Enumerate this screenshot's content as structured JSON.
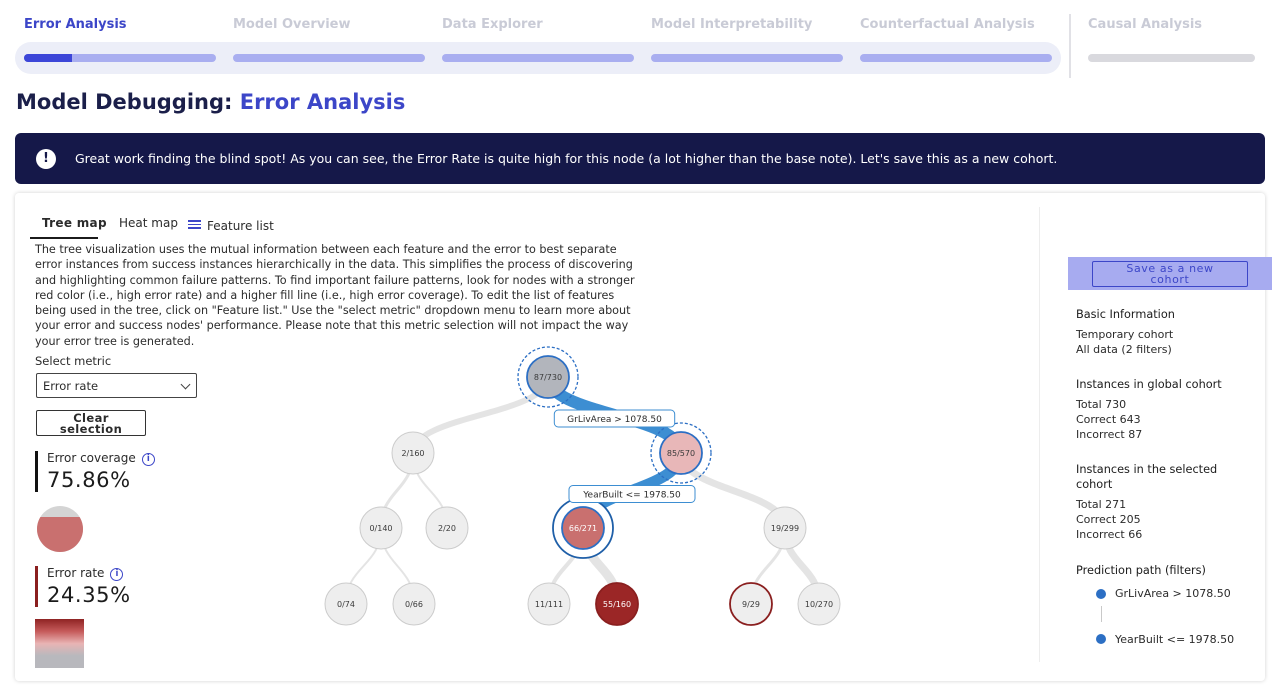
{
  "steps": [
    {
      "label": "Error Analysis",
      "active": true,
      "progress": 0.25
    },
    {
      "label": "Model Overview",
      "active": false,
      "progress": 0
    },
    {
      "label": "Data Explorer",
      "active": false,
      "progress": 0
    },
    {
      "label": "Model Interpretability",
      "active": false,
      "progress": 0
    },
    {
      "label": "Counterfactual Analysis",
      "active": false,
      "progress": 0
    },
    {
      "label": "Causal Analysis",
      "active": false,
      "progress": 0
    }
  ],
  "title": {
    "prefix": "Model Debugging:",
    "accent": "Error Analysis"
  },
  "banner": {
    "icon": "!",
    "text": "Great work finding the blind spot! As you can see, the Error Rate is quite high for this node (a lot higher than the base note). Let's save this as a new cohort."
  },
  "tabs": {
    "tree_map": "Tree map",
    "heat_map": "Heat map",
    "feature_list": "Feature list"
  },
  "description": "The tree visualization uses the mutual information between each feature and the error to best separate error instances from success instances hierarchically in the data. This simplifies the process of discovering and highlighting common failure patterns. To find important failure patterns, look for nodes with a stronger red color (i.e., high error rate) and a higher fill line (i.e., high error coverage). To edit the list of features being used in the tree, click on \"Feature list.\" Use the \"select metric\" dropdown menu to learn more about your error and success nodes' performance. Please note that this metric selection will not impact the way your error tree is generated.",
  "metric": {
    "label": "Select metric",
    "selected": "Error rate"
  },
  "clear_button": {
    "line1": "Clear",
    "line2": "selection"
  },
  "coverage": {
    "label": "Error coverage",
    "value": "75.86%",
    "fraction": 0.7586,
    "info_icon": "i"
  },
  "error_rate": {
    "label": "Error rate",
    "value": "24.35%",
    "info_icon": "i"
  },
  "colors": {
    "accent": "#3c46c8",
    "banner_bg": "#151849",
    "edge_selected": "#3d8ed2",
    "edge_default": "#e4e4e4"
  },
  "tree": {
    "nodes": [
      {
        "id": "root",
        "label": "87/730",
        "fill": "#b2b5bc",
        "stroke": "#2c6fc4",
        "ring": "dashed",
        "light": false
      },
      {
        "id": "n1",
        "label": "2/160",
        "fill": "#eeeeee",
        "stroke": "#cccccc",
        "ring": "none",
        "light": false
      },
      {
        "id": "n2",
        "label": "85/570",
        "fill": "#e8b7b8",
        "stroke": "#2c6fc4",
        "ring": "dashed",
        "light": false
      },
      {
        "id": "n3",
        "label": "0/140",
        "fill": "#eeeeee",
        "stroke": "#cccccc",
        "ring": "none",
        "light": false
      },
      {
        "id": "n4",
        "label": "2/20",
        "fill": "#eeeeee",
        "stroke": "#cccccc",
        "ring": "none",
        "light": false
      },
      {
        "id": "n5",
        "label": "66/271",
        "fill": "#c9706f",
        "stroke": "#2c6fc4",
        "ring": "solid",
        "light": true
      },
      {
        "id": "n6",
        "label": "19/299",
        "fill": "#eeeeee",
        "stroke": "#cccccc",
        "ring": "none",
        "light": false
      },
      {
        "id": "n7",
        "label": "0/74",
        "fill": "#eeeeee",
        "stroke": "#cccccc",
        "ring": "none",
        "light": false
      },
      {
        "id": "n8",
        "label": "0/66",
        "fill": "#eeeeee",
        "stroke": "#cccccc",
        "ring": "none",
        "light": false
      },
      {
        "id": "n9",
        "label": "11/111",
        "fill": "#eeeeee",
        "stroke": "#cccccc",
        "ring": "none",
        "light": false
      },
      {
        "id": "n10",
        "label": "55/160",
        "fill": "#9b2626",
        "stroke": "#8a1f1f",
        "ring": "none",
        "light": true
      },
      {
        "id": "n11",
        "label": "9/29",
        "fill": "#eeeeee",
        "stroke": "#8a1f1f",
        "ring": "none",
        "light": false
      },
      {
        "id": "n12",
        "label": "10/270",
        "fill": "#eeeeee",
        "stroke": "#cccccc",
        "ring": "none",
        "light": false
      }
    ],
    "edge_labels": [
      {
        "from": "root",
        "to": "n2",
        "text": "GrLivArea > 1078.50"
      },
      {
        "from": "n2",
        "to": "n5",
        "text": "YearBuilt <= 1978.50"
      }
    ]
  },
  "save_button": {
    "line1": "Save as a new",
    "line2": "cohort"
  },
  "basic_info": {
    "heading": "Basic Information",
    "lines": [
      "Temporary cohort",
      "All data (2 filters)"
    ]
  },
  "global_cohort": {
    "heading": "Instances in global cohort",
    "lines": [
      "Total 730",
      "Correct 643",
      "Incorrect 87"
    ]
  },
  "selected_cohort": {
    "heading_line1": "Instances in the selected",
    "heading_line2": "cohort",
    "lines": [
      "Total 271",
      "Correct 205",
      "Incorrect 66"
    ]
  },
  "prediction_path": {
    "heading": "Prediction path (filters)",
    "filters": [
      "GrLivArea > 1078.50",
      "YearBuilt <= 1978.50"
    ]
  }
}
